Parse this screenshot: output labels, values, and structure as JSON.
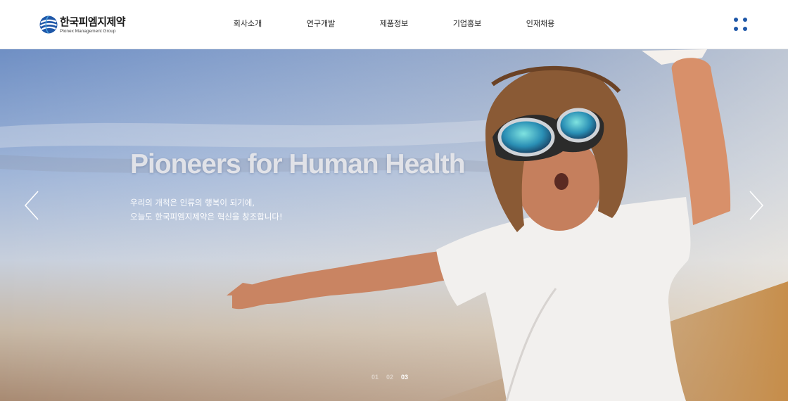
{
  "brand": {
    "name_ko": "한국피엠지제약",
    "name_en": "Pionex Management Group",
    "color": "#1e57a8"
  },
  "nav": {
    "items": [
      {
        "label": "회사소개"
      },
      {
        "label": "연구개발"
      },
      {
        "label": "제품정보"
      },
      {
        "label": "기업홍보"
      },
      {
        "label": "인재채용"
      }
    ],
    "menu_icon": "grid-dots-icon"
  },
  "hero": {
    "title": "Pioneers for Human Health",
    "subtitle_line1": "우리의 개척은 인류의 행복이 되기에,",
    "subtitle_line2": "오늘도 한국피엠지제약은 혁신을 창조합니다!",
    "prev_icon": "chevron-left-icon",
    "next_icon": "chevron-right-icon"
  },
  "pager": {
    "pages": [
      "01",
      "02",
      "03"
    ],
    "active": "03"
  }
}
